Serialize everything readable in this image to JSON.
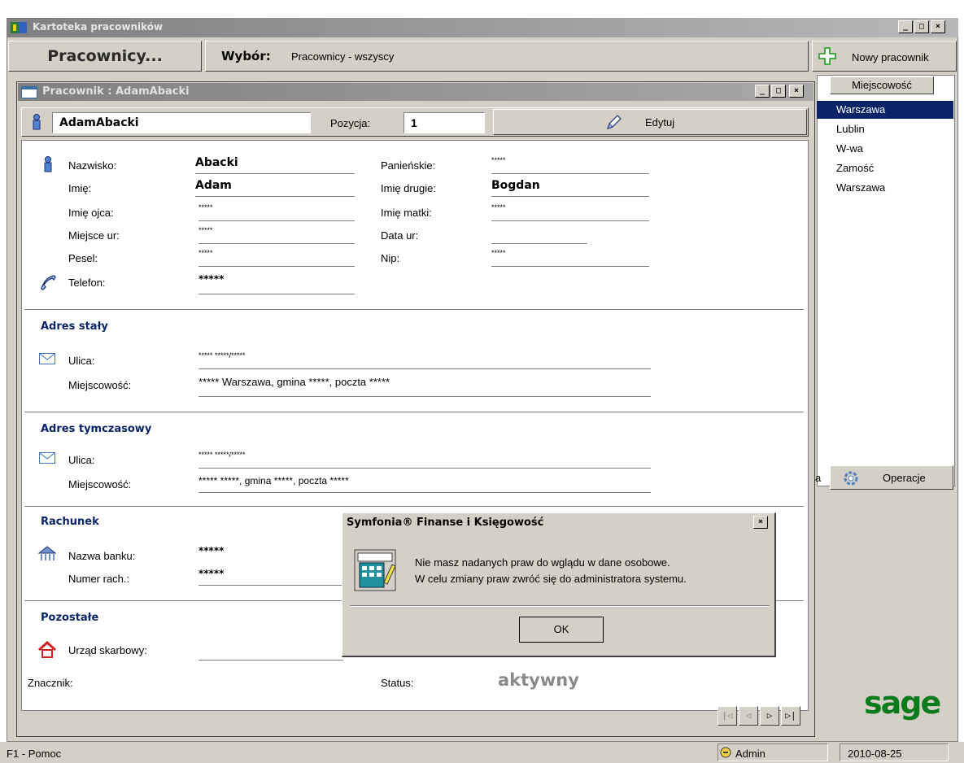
{
  "main_window": {
    "title": "Kartoteka pracowników"
  },
  "toolbar": {
    "pracownicy_label": "Pracownicy...",
    "wybor_label": "Wybór:",
    "wybor_value": "Pracownicy - wszyscy",
    "nowy_label": "Nowy pracownik"
  },
  "right_panel": {
    "header": "Miejscowość",
    "cities": [
      "Warszawa",
      "Lublin",
      "W-wa",
      "Zamość",
      "Warszawa"
    ],
    "selected_index": 0,
    "operacje_label": "Operacje",
    "partial_label": "a"
  },
  "child_window": {
    "title": "Pracownik : AdamAbacki"
  },
  "name_bar": {
    "name_value": "AdamAbacki",
    "pozycja_label": "Pozycja:",
    "pozycja_value": "1",
    "edytuj_label": "Edytuj"
  },
  "personal": {
    "nazwisko_label": "Nazwisko:",
    "nazwisko_value": "Abacki",
    "imie_label": "Imię:",
    "imie_value": "Adam",
    "imie_ojca_label": "Imię ojca:",
    "imie_ojca_value": "*****",
    "miejsce_ur_label": "Miejsce ur:",
    "miejsce_ur_value": "*****",
    "pesel_label": "Pesel:",
    "pesel_value": "*****",
    "telefon_label": "Telefon:",
    "telefon_value": "*****",
    "panienskie_label": "Panieńskie:",
    "panienskie_value": "*****",
    "imie_drugie_label": "Imię drugie:",
    "imie_drugie_value": "Bogdan",
    "imie_matki_label": "Imię matki:",
    "imie_matki_value": "*****",
    "data_ur_label": "Data ur:",
    "data_ur_value": "",
    "nip_label": "Nip:",
    "nip_value": "*****"
  },
  "adres_staly": {
    "header": "Adres stały",
    "ulica_label": "Ulica:",
    "ulica_value": "***** *****/*****",
    "miejscowosc_label": "Miejscowość:",
    "miejscowosc_value": "***** Warszawa, gmina *****, poczta *****"
  },
  "adres_tymczasowy": {
    "header": "Adres tymczasowy",
    "ulica_label": "Ulica:",
    "ulica_value": "***** *****/*****",
    "miejscowosc_label": "Miejscowość:",
    "miejscowosc_value": "***** *****, gmina *****, poczta *****"
  },
  "rachunek": {
    "header": "Rachunek",
    "bank_label": "Nazwa banku:",
    "bank_value": "*****",
    "numer_label": "Numer rach.:",
    "numer_value": "*****"
  },
  "pozostale": {
    "header": "Pozostałe",
    "urzad_label": "Urząd skarbowy:",
    "znacznik_label": "Znacznik:",
    "status_label": "Status:",
    "status_value": "aktywny"
  },
  "dialog": {
    "title": "Symfonia® Finanse i Księgowość",
    "line1": "Nie masz nadanych praw do wglądu w dane osobowe.",
    "line2": "W celu zmiany praw zwróć się do administratora systemu.",
    "ok_label": "OK"
  },
  "statusbar": {
    "help": "F1 - Pomoc",
    "user": "Admin",
    "date": "2010-08-25"
  },
  "logo": {
    "text": "sage"
  },
  "window_buttons": {
    "minimize": "_",
    "maximize": "□",
    "close": "×"
  }
}
